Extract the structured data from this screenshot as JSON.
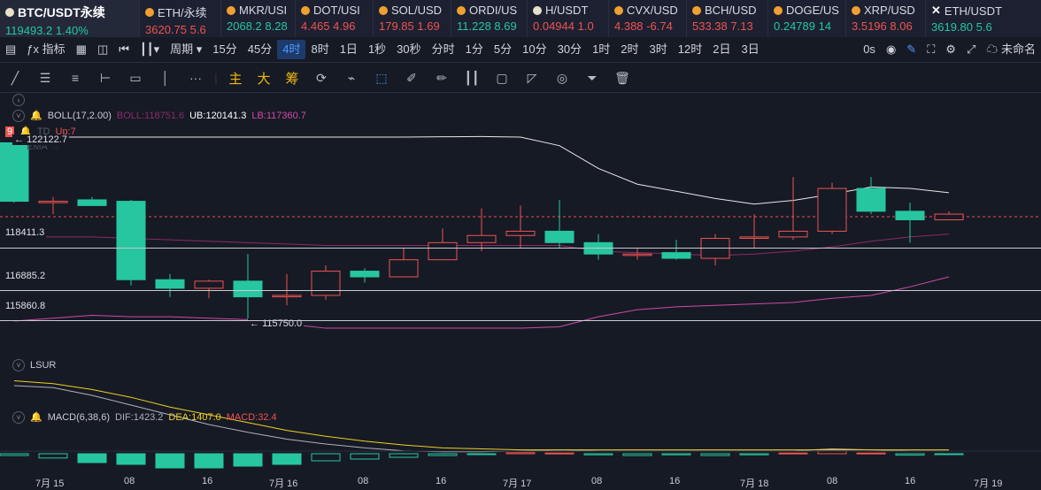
{
  "tickers": [
    {
      "symbol": "BTC/USDT永续",
      "price": "119493.2",
      "change": "1.40%",
      "dir": "up",
      "active": true,
      "coin": "w",
      "w": 158
    },
    {
      "symbol": "ETH/永续",
      "price": "3620.75",
      "change": "5.6",
      "dir": "dn",
      "coin": "o",
      "w": 92
    },
    {
      "symbol": "MKR/USI",
      "price": "2068.2",
      "change": "8.28",
      "dir": "up",
      "coin": "o",
      "w": 84
    },
    {
      "symbol": "DOT/USI",
      "price": "4.465",
      "change": "4.96",
      "dir": "dn",
      "coin": "o",
      "w": 88
    },
    {
      "symbol": "SOL/USD",
      "price": "179.85",
      "change": "1.69",
      "dir": "dn",
      "coin": "o",
      "w": 88
    },
    {
      "symbol": "ORDI/US",
      "price": "11.228",
      "change": "8.69",
      "dir": "up",
      "coin": "o",
      "w": 86
    },
    {
      "symbol": "H/USDT",
      "price": "0.04944",
      "change": "1.0",
      "dir": "dn",
      "coin": "w",
      "w": 92
    },
    {
      "symbol": "CVX/USD",
      "price": "4.388",
      "change": "-6.74",
      "dir": "dn",
      "coin": "o",
      "w": 88
    },
    {
      "symbol": "BCH/USD",
      "price": "533.38",
      "change": "7.13",
      "dir": "dn",
      "coin": "o",
      "w": 92
    },
    {
      "symbol": "DOGE/US",
      "price": "0.24789",
      "change": "14",
      "dir": "up",
      "coin": "o",
      "w": 88
    },
    {
      "symbol": "XRP/USD",
      "price": "3.5196",
      "change": "8.06",
      "dir": "dn",
      "coin": "o",
      "w": 90
    },
    {
      "symbol": "ETH/USDT",
      "price": "3619.80",
      "change": "5.6",
      "dir": "up",
      "coin": "x",
      "w": 140
    }
  ],
  "toolbar": {
    "indicators": "指标",
    "period": "周期",
    "intervals": [
      "15分",
      "45分",
      "4时",
      "8时",
      "1日",
      "1秒",
      "30秒",
      "分时",
      "1分",
      "5分",
      "10分",
      "30分",
      "1时",
      "2时",
      "3时",
      "12时",
      "2日",
      "3日"
    ],
    "selected_interval": "4时",
    "countdown": "0s",
    "unnamed": "未命名"
  },
  "drawtools": {
    "main": "主",
    "big": "大",
    "chip": "筹"
  },
  "indicators": {
    "boll": {
      "label": "BOLL(17,2.00)",
      "boll": "BOLL:118751.6",
      "ub": "UB:120141.3",
      "lb": "LB:117360.7"
    },
    "td": {
      "label": "TD",
      "up": "Up:7",
      "badge": "9"
    },
    "ema": "EMA",
    "lsur": "LSUR",
    "macd": {
      "label": "MACD(6,38,6)",
      "dif": "DIF:1423.2",
      "dea": "DEA:1407.0",
      "macd": "MACD:32.4"
    }
  },
  "price_labels": {
    "high": "122122.7",
    "low": "115750.0",
    "l1": "118411.3",
    "l2": "116885.2",
    "l3": "115860.8"
  },
  "x_labels": [
    "7月 15",
    "08",
    "16",
    "7月 16",
    "08",
    "16",
    "7月 17",
    "08",
    "16",
    "7月 18",
    "08",
    "16",
    "7月 19"
  ],
  "colors": {
    "up": "#26c6a0",
    "down": "#ef5350",
    "ub": "#e8e8e8",
    "lb": "#d04aa8",
    "mid": "#8a2a6a",
    "dea": "#f0d020",
    "dif": "#b0b0b8"
  },
  "chart_data": {
    "type": "candlestick",
    "candles": [
      {
        "o": 122000,
        "h": 122300,
        "l": 119900,
        "c": 119950
      },
      {
        "o": 119900,
        "h": 120100,
        "l": 119500,
        "c": 119950
      },
      {
        "o": 120000,
        "h": 120100,
        "l": 119800,
        "c": 119800
      },
      {
        "o": 119950,
        "h": 120000,
        "l": 117000,
        "c": 117200
      },
      {
        "o": 117200,
        "h": 117400,
        "l": 116600,
        "c": 116900
      },
      {
        "o": 116900,
        "h": 117200,
        "l": 116550,
        "c": 117150
      },
      {
        "o": 117150,
        "h": 118100,
        "l": 115750,
        "c": 116600
      },
      {
        "o": 116600,
        "h": 117400,
        "l": 116300,
        "c": 116650
      },
      {
        "o": 116650,
        "h": 117700,
        "l": 116500,
        "c": 117500
      },
      {
        "o": 117500,
        "h": 117600,
        "l": 117100,
        "c": 117300
      },
      {
        "o": 117300,
        "h": 118300,
        "l": 117300,
        "c": 117900
      },
      {
        "o": 117900,
        "h": 119000,
        "l": 117900,
        "c": 118500
      },
      {
        "o": 118500,
        "h": 119700,
        "l": 118200,
        "c": 118750
      },
      {
        "o": 118750,
        "h": 119800,
        "l": 118300,
        "c": 118900
      },
      {
        "o": 118900,
        "h": 120000,
        "l": 118300,
        "c": 118500
      },
      {
        "o": 118500,
        "h": 118800,
        "l": 117900,
        "c": 118100
      },
      {
        "o": 118050,
        "h": 118300,
        "l": 117900,
        "c": 118100
      },
      {
        "o": 118150,
        "h": 118600,
        "l": 117900,
        "c": 117950
      },
      {
        "o": 117950,
        "h": 118800,
        "l": 117700,
        "c": 118650
      },
      {
        "o": 118650,
        "h": 119500,
        "l": 118300,
        "c": 118700
      },
      {
        "o": 118700,
        "h": 120800,
        "l": 118600,
        "c": 118900
      },
      {
        "o": 118900,
        "h": 120600,
        "l": 118800,
        "c": 120400
      },
      {
        "o": 120400,
        "h": 120800,
        "l": 119500,
        "c": 119600
      },
      {
        "o": 119600,
        "h": 119900,
        "l": 118500,
        "c": 119300
      },
      {
        "o": 119300,
        "h": 119600,
        "l": 119300,
        "c": 119500
      }
    ],
    "ub": [
      122200,
      122200,
      122200,
      122200,
      122200,
      122200,
      122200,
      122200,
      122200,
      122200,
      122200,
      122210,
      122220,
      122200,
      121900,
      121100,
      120550,
      120300,
      120050,
      119850,
      119980,
      120200,
      120450,
      120400,
      120250
    ],
    "lb": [
      115750,
      115850,
      115950,
      115900,
      115900,
      115850,
      115800,
      115650,
      115500,
      115500,
      115500,
      115500,
      115500,
      115500,
      115550,
      115900,
      116150,
      116250,
      116300,
      116350,
      116400,
      116550,
      116650,
      116950,
      117300
    ],
    "mid": [
      118700,
      118700,
      118700,
      118650,
      118600,
      118550,
      118500,
      118450,
      118400,
      118400,
      118400,
      118400,
      118400,
      118400,
      118400,
      118200,
      118150,
      118100,
      118050,
      118100,
      118200,
      118350,
      118550,
      118700,
      118800
    ],
    "macd_hist": [
      -5,
      -12,
      -25,
      -30,
      -40,
      -40,
      -35,
      -30,
      -20,
      -15,
      -10,
      -5,
      -2,
      3,
      2,
      -3,
      -5,
      -3,
      -5,
      -3,
      2,
      8,
      2,
      -4,
      -1
    ],
    "dif": [
      70,
      68,
      60,
      50,
      40,
      30,
      22,
      15,
      10,
      6,
      3,
      2,
      2,
      3,
      4,
      3,
      3,
      3,
      3,
      3,
      3,
      5,
      4,
      3,
      3
    ],
    "dea": [
      75,
      72,
      66,
      58,
      48,
      40,
      32,
      24,
      18,
      13,
      9,
      6,
      5,
      4,
      4,
      4,
      4,
      4,
      4,
      4,
      4,
      4,
      4,
      4,
      4
    ]
  }
}
